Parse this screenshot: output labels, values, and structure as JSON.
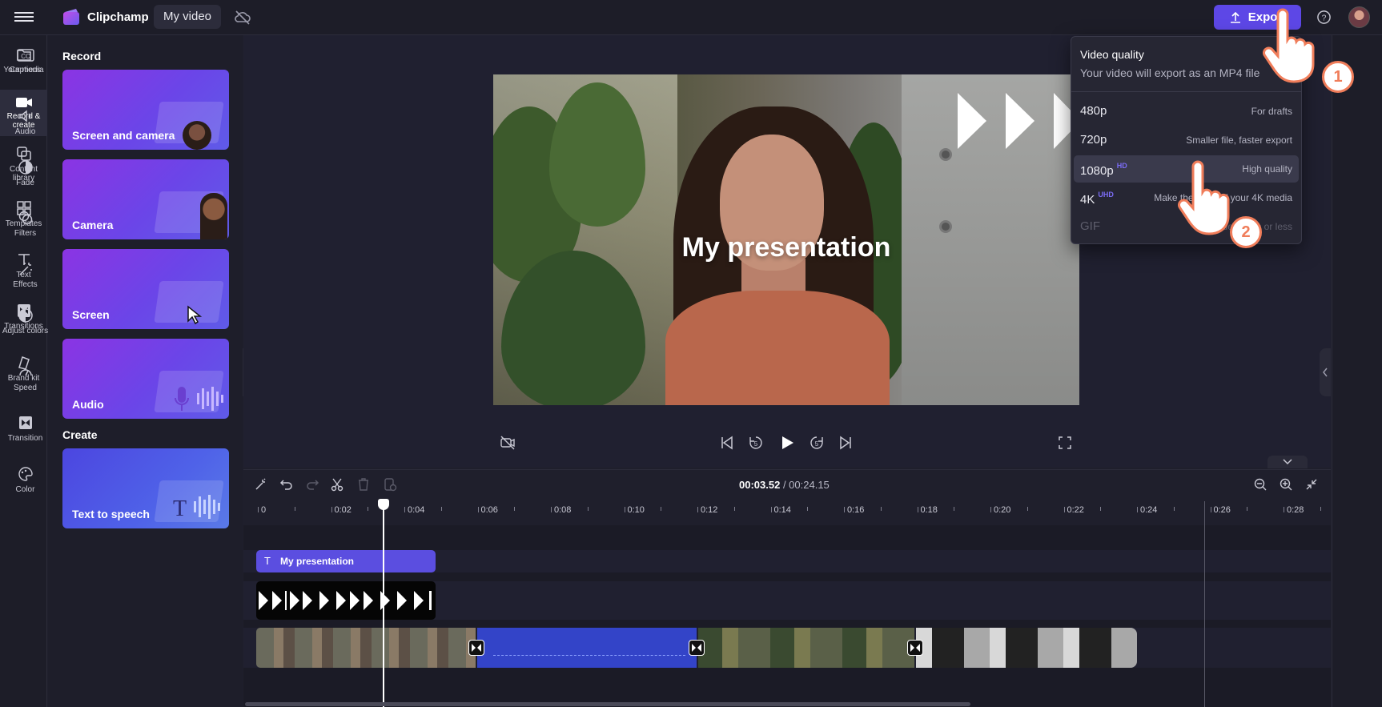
{
  "topbar": {
    "brand": "Clipchamp",
    "video_name": "My video",
    "export_label": "Export"
  },
  "left_nav": [
    {
      "label": "Your media",
      "icon": "folder-icon"
    },
    {
      "label": "Record & create",
      "icon": "camera-icon"
    },
    {
      "label": "Content library",
      "icon": "library-icon"
    },
    {
      "label": "Templates",
      "icon": "templates-icon"
    },
    {
      "label": "Text",
      "icon": "text-icon"
    },
    {
      "label": "Transitions",
      "icon": "transitions-icon"
    },
    {
      "label": "Brand kit",
      "icon": "brand-kit-icon"
    }
  ],
  "panel": {
    "record_heading": "Record",
    "create_heading": "Create",
    "cards": [
      {
        "label": "Screen and camera"
      },
      {
        "label": "Camera"
      },
      {
        "label": "Screen"
      },
      {
        "label": "Audio"
      }
    ],
    "create_cards": [
      {
        "label": "Text to speech"
      }
    ]
  },
  "preview": {
    "title_overlay": "My presentation"
  },
  "timeline": {
    "current_time": "00:03.52",
    "total_time": "/ 00:24.15",
    "ruler_labels": [
      "0",
      "0:02",
      "0:04",
      "0:06",
      "0:08",
      "0:10",
      "0:12",
      "0:14",
      "0:16",
      "0:18",
      "0:20",
      "0:22",
      "0:24",
      "0:26",
      "0:28"
    ],
    "text_clip_label": "My presentation"
  },
  "right_nav": [
    {
      "label": "Captions",
      "icon": "captions-icon"
    },
    {
      "label": "Audio",
      "icon": "audio-icon"
    },
    {
      "label": "Fade",
      "icon": "fade-icon"
    },
    {
      "label": "Filters",
      "icon": "filters-icon"
    },
    {
      "label": "Effects",
      "icon": "effects-icon"
    },
    {
      "label": "Adjust colors",
      "icon": "adjust-colors-icon"
    },
    {
      "label": "Speed",
      "icon": "speed-icon"
    },
    {
      "label": "Transition",
      "icon": "transition-icon"
    },
    {
      "label": "Color",
      "icon": "color-icon"
    }
  ],
  "export_menu": {
    "title": "Video quality",
    "subtitle": "Your video will export as an MP4 file",
    "options": [
      {
        "name": "480p",
        "badge": "",
        "desc": "For drafts",
        "state": "normal"
      },
      {
        "name": "720p",
        "badge": "",
        "desc": "Smaller file, faster export",
        "state": "normal"
      },
      {
        "name": "1080p",
        "badge": "HD",
        "desc": "High quality",
        "state": "selected"
      },
      {
        "name": "4K",
        "badge": "UHD",
        "desc": "Make the most of your 4K media",
        "state": "normal"
      },
      {
        "name": "GIF",
        "badge": "",
        "desc": "For videos 15s or less",
        "state": "disabled"
      }
    ]
  },
  "annotations": {
    "step1": "1",
    "step2": "2"
  },
  "colors": {
    "accent": "#5d47e6",
    "step_badge": "#f07d5a"
  }
}
